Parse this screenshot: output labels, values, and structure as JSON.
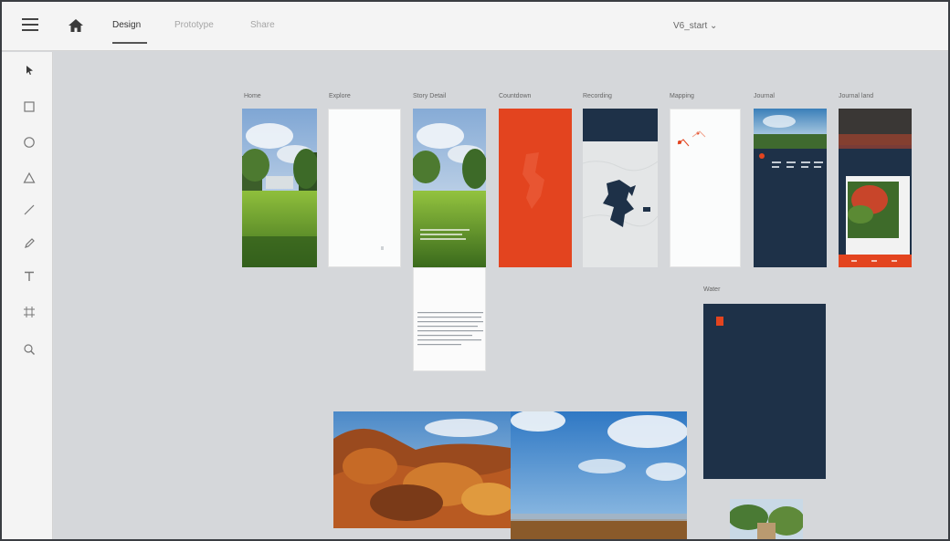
{
  "tabs": [
    {
      "label": "Design",
      "active": true
    },
    {
      "label": "Prototype",
      "active": false
    },
    {
      "label": "Share",
      "active": false
    }
  ],
  "document": {
    "title": "V6_start ⌄"
  },
  "tools": [
    "select-tool",
    "rectangle-tool",
    "ellipse-tool",
    "polygon-tool",
    "line-tool",
    "pen-tool",
    "text-tool",
    "artboard-tool",
    "zoom-tool"
  ],
  "artboards": [
    {
      "label": "Home"
    },
    {
      "label": "Explore"
    },
    {
      "label": "Story Detail"
    },
    {
      "label": "Countdown"
    },
    {
      "label": "Recording"
    },
    {
      "label": "Mapping"
    },
    {
      "label": "Journal"
    },
    {
      "label": "Journal land"
    },
    {
      "label": "Water"
    }
  ],
  "colors": {
    "accent_orange": "#e3441f",
    "navy": "#1e3148",
    "canvas": "#d5d7da"
  }
}
